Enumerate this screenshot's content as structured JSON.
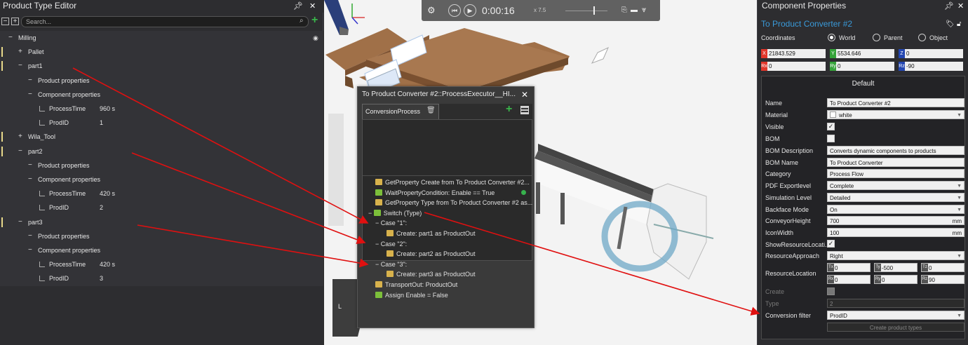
{
  "left_panel": {
    "title": "Product Type Editor",
    "search_placeholder": "Search...",
    "rows": [
      {
        "label": "Milling",
        "value": ""
      },
      {
        "label": "Pallet",
        "value": ""
      },
      {
        "label": "part1",
        "value": ""
      },
      {
        "label": "Product properties",
        "value": ""
      },
      {
        "label": "Component properties",
        "value": ""
      },
      {
        "label": "ProcessTime",
        "value": "960 s"
      },
      {
        "label": "ProdID",
        "value": "1"
      },
      {
        "label": "Wila_Tool",
        "value": ""
      },
      {
        "label": "part2",
        "value": ""
      },
      {
        "label": "Product properties",
        "value": ""
      },
      {
        "label": "Component properties",
        "value": ""
      },
      {
        "label": "ProcessTime",
        "value": "420 s"
      },
      {
        "label": "ProdID",
        "value": "2"
      },
      {
        "label": "part3",
        "value": ""
      },
      {
        "label": "Product properties",
        "value": ""
      },
      {
        "label": "Component properties",
        "value": ""
      },
      {
        "label": "ProcessTime",
        "value": "420 s"
      },
      {
        "label": "ProdID",
        "value": "3"
      }
    ]
  },
  "toolbar": {
    "time": "0:00:16",
    "speed": "x 7.5"
  },
  "dialog": {
    "title": "To Product Converter #2::ProcessExecutor__HI...",
    "tab": "ConversionProcess",
    "statements": [
      "GetProperty Create from To Product Converter #2...",
      "WaitPropertyCondition: Enable == True",
      "GetProperty Type from To Product Converter #2 as...",
      "Switch (Type)",
      "Case \"1\":",
      "Create: part1 as ProductOut",
      "Case \"2\":",
      "Create: part2 as ProductOut",
      "Case \"3\":",
      "Create: part3 as ProductOut",
      "TransportOut: ProductOut",
      "Assign Enable = False"
    ]
  },
  "right_panel": {
    "title": "Component Properties",
    "component_name": "To Product Converter #2",
    "coordinates_label": "Coordinates",
    "coord_modes": [
      "World",
      "Parent",
      "Object"
    ],
    "x": "21843.529",
    "y": "5534.646",
    "z": "0",
    "rx": "0",
    "ry": "0",
    "rz": "-90",
    "group": "Default",
    "props": {
      "name_label": "Name",
      "name": "To Product Converter #2",
      "material_label": "Material",
      "material": "white",
      "visible_label": "Visible",
      "bom_label": "BOM",
      "bom_desc_label": "BOM Description",
      "bom_desc": "Converts dynamic components to products",
      "bom_name_label": "BOM Name",
      "bom_name": "To Product Converter",
      "category_label": "Category",
      "category": "Process Flow",
      "pdf_label": "PDF Exportlevel",
      "pdf": "Complete",
      "sim_label": "Simulation Level",
      "sim": "Detailed",
      "backface_label": "Backface Mode",
      "backface": "On",
      "conv_height_label": "ConveyorHeight",
      "conv_height": "700",
      "icon_width_label": "IconWidth",
      "icon_width": "100",
      "unit": "mm",
      "show_res_label": "ShowResourceLocati...",
      "res_approach_label": "ResourceApproach",
      "res_approach": "Right",
      "res_loc_label": "ResourceLocation",
      "tx": "0",
      "ty": "-500",
      "tz": "0",
      "rx": "0",
      "ry": "0",
      "rz": "90",
      "create_label": "Create",
      "type_label": "Type",
      "type": "2",
      "conv_filter_label": "Conversion filter",
      "conv_filter": "ProdID",
      "create_btn": "Create product types"
    }
  },
  "colors": {
    "accent_blue": "#3a9ad9",
    "arrow_red": "#e01010",
    "add_green": "#39b54a"
  }
}
